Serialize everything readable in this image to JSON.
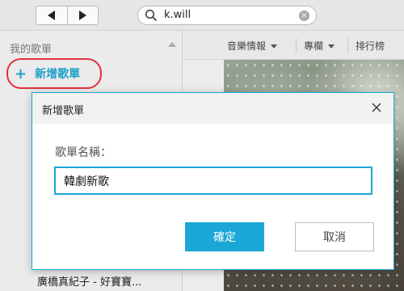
{
  "toolbar": {
    "back_icon": "triangle-left-icon",
    "forward_icon": "triangle-right-icon",
    "search_icon": "magnifier-icon",
    "search_value": "k.will",
    "clear_icon": "clear-circle-icon"
  },
  "sidebar": {
    "title": "我的歌單",
    "add_label": "新增歌單",
    "add_symbol": "+",
    "highlight_color": "#e1303a",
    "song_partial": "廣橋真紀子 - 好寶寶..."
  },
  "tabs": [
    {
      "label": "音樂情報"
    },
    {
      "label": "專欄"
    },
    {
      "label": "排行榜"
    }
  ],
  "dialog": {
    "title": "新增歌單",
    "field_label": "歌單名稱：",
    "input_value": "韓劇新歌",
    "ok_label": "確定",
    "cancel_label": "取消",
    "accent_color": "#1aa7d6"
  }
}
